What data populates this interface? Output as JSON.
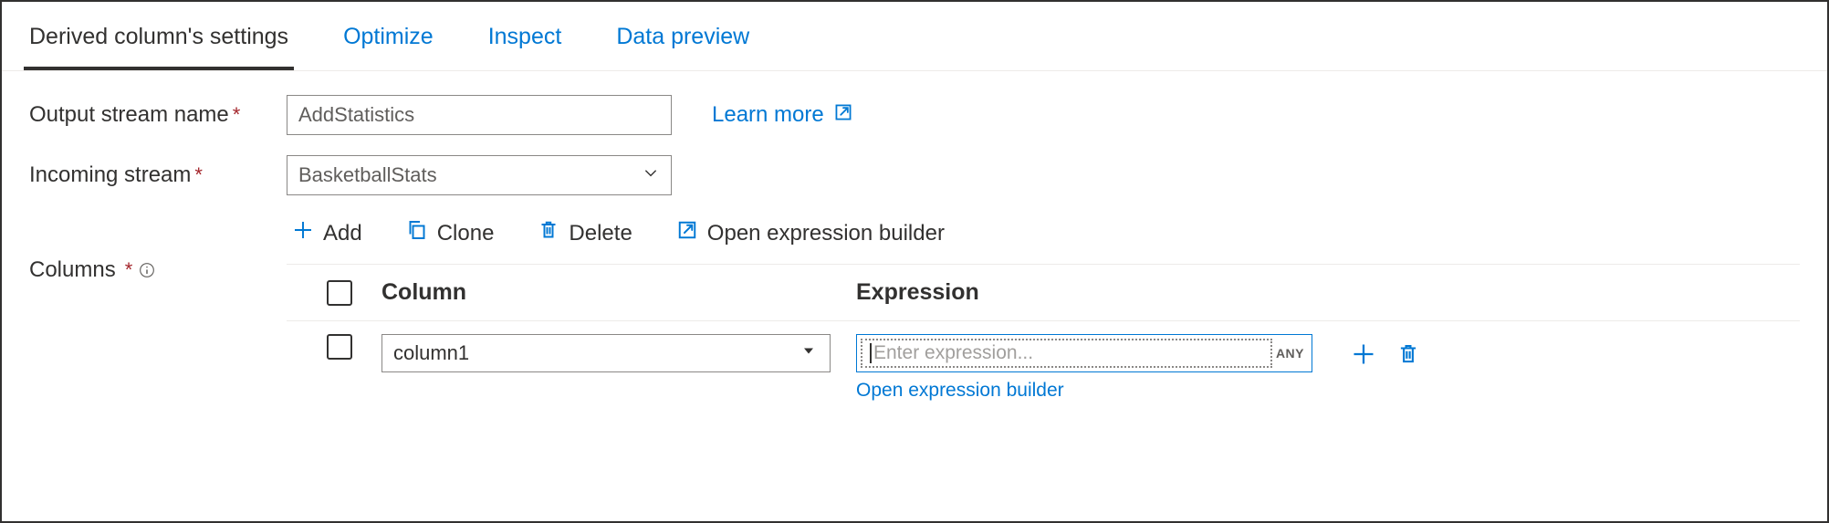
{
  "tabs": {
    "settings": "Derived column's settings",
    "optimize": "Optimize",
    "inspect": "Inspect",
    "preview": "Data preview"
  },
  "form": {
    "output_stream_label": "Output stream name",
    "output_stream_value": "AddStatistics",
    "incoming_stream_label": "Incoming stream",
    "incoming_stream_value": "BasketballStats",
    "learn_more": "Learn more"
  },
  "columns": {
    "label": "Columns",
    "toolbar": {
      "add": "Add",
      "clone": "Clone",
      "delete": "Delete",
      "open_builder": "Open expression builder"
    },
    "headers": {
      "column": "Column",
      "expression": "Expression"
    },
    "rows": [
      {
        "column": "column1",
        "expression_placeholder": "Enter expression...",
        "expression_value": "",
        "type_badge": "ANY"
      }
    ],
    "open_builder_link": "Open expression builder"
  }
}
